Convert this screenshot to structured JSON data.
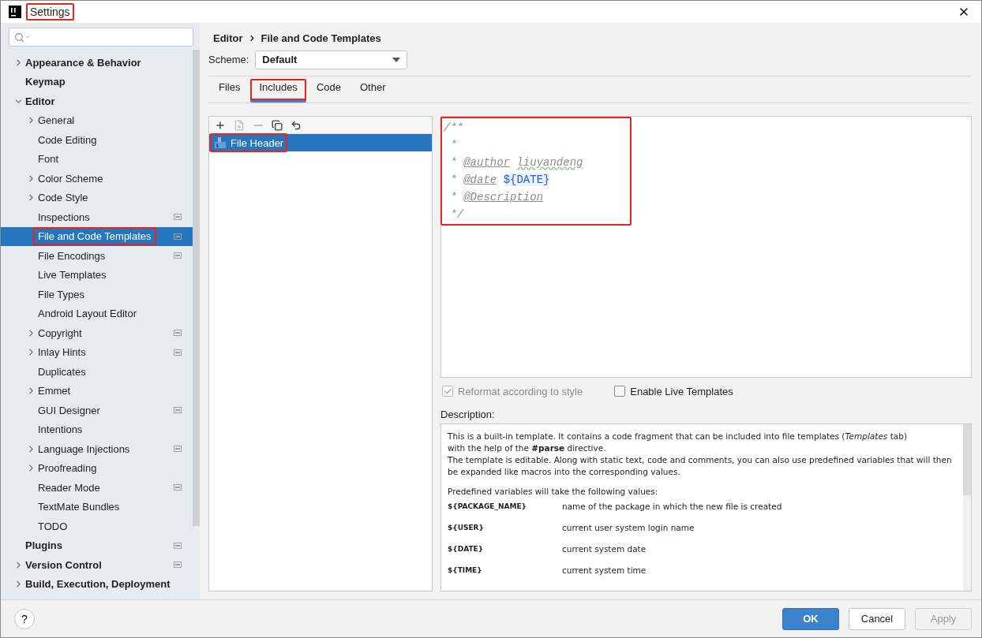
{
  "window": {
    "title": "Settings",
    "title_highlighted": true
  },
  "tree": [
    {
      "label": "Appearance & Behavior",
      "expandable": true,
      "expanded": false,
      "badge": false,
      "selected": false,
      "highlighted": false
    },
    {
      "label": "Keymap",
      "expandable": false,
      "badge": false,
      "selected": false,
      "highlighted": false
    },
    {
      "label": "Editor",
      "expandable": true,
      "expanded": true,
      "badge": false,
      "selected": false,
      "highlighted": false,
      "children": [
        {
          "label": "General",
          "expandable": true,
          "expanded": false,
          "badge": false,
          "selected": false,
          "highlighted": false
        },
        {
          "label": "Code Editing",
          "expandable": false,
          "badge": false,
          "selected": false,
          "highlighted": false
        },
        {
          "label": "Font",
          "expandable": false,
          "badge": false,
          "selected": false,
          "highlighted": false
        },
        {
          "label": "Color Scheme",
          "expandable": true,
          "expanded": false,
          "badge": false,
          "selected": false,
          "highlighted": false
        },
        {
          "label": "Code Style",
          "expandable": true,
          "expanded": false,
          "badge": false,
          "selected": false,
          "highlighted": false
        },
        {
          "label": "Inspections",
          "expandable": false,
          "badge": true,
          "selected": false,
          "highlighted": false
        },
        {
          "label": "File and Code Templates",
          "expandable": false,
          "badge": true,
          "selected": true,
          "highlighted": true
        },
        {
          "label": "File Encodings",
          "expandable": false,
          "badge": true,
          "selected": false,
          "highlighted": false
        },
        {
          "label": "Live Templates",
          "expandable": false,
          "badge": false,
          "selected": false,
          "highlighted": false
        },
        {
          "label": "File Types",
          "expandable": false,
          "badge": false,
          "selected": false,
          "highlighted": false
        },
        {
          "label": "Android Layout Editor",
          "expandable": false,
          "badge": false,
          "selected": false,
          "highlighted": false
        },
        {
          "label": "Copyright",
          "expandable": true,
          "expanded": false,
          "badge": true,
          "selected": false,
          "highlighted": false
        },
        {
          "label": "Inlay Hints",
          "expandable": true,
          "expanded": false,
          "badge": true,
          "selected": false,
          "highlighted": false
        },
        {
          "label": "Duplicates",
          "expandable": false,
          "badge": false,
          "selected": false,
          "highlighted": false
        },
        {
          "label": "Emmet",
          "expandable": true,
          "expanded": false,
          "badge": false,
          "selected": false,
          "highlighted": false
        },
        {
          "label": "GUI Designer",
          "expandable": false,
          "badge": true,
          "selected": false,
          "highlighted": false
        },
        {
          "label": "Intentions",
          "expandable": false,
          "badge": false,
          "selected": false,
          "highlighted": false
        },
        {
          "label": "Language Injections",
          "expandable": true,
          "expanded": false,
          "badge": true,
          "selected": false,
          "highlighted": false
        },
        {
          "label": "Proofreading",
          "expandable": true,
          "expanded": false,
          "badge": false,
          "selected": false,
          "highlighted": false
        },
        {
          "label": "Reader Mode",
          "expandable": false,
          "badge": true,
          "selected": false,
          "highlighted": false
        },
        {
          "label": "TextMate Bundles",
          "expandable": false,
          "badge": false,
          "selected": false,
          "highlighted": false
        },
        {
          "label": "TODO",
          "expandable": false,
          "badge": false,
          "selected": false,
          "highlighted": false
        }
      ]
    },
    {
      "label": "Plugins",
      "expandable": false,
      "badge": true,
      "selected": false,
      "highlighted": false
    },
    {
      "label": "Version Control",
      "expandable": true,
      "expanded": false,
      "badge": true,
      "selected": false,
      "highlighted": false
    },
    {
      "label": "Build, Execution, Deployment",
      "expandable": true,
      "expanded": false,
      "badge": false,
      "selected": false,
      "highlighted": false
    }
  ],
  "breadcrumb": [
    "Editor",
    "File and Code Templates"
  ],
  "scheme": {
    "label": "Scheme:",
    "value": "Default"
  },
  "tabs": [
    {
      "label": "Files",
      "selected": false,
      "highlighted": false
    },
    {
      "label": "Includes",
      "selected": true,
      "highlighted": true
    },
    {
      "label": "Code",
      "selected": false,
      "highlighted": false
    },
    {
      "label": "Other",
      "selected": false,
      "highlighted": false
    }
  ],
  "toolbar": [
    {
      "kind": "add",
      "disabled": false
    },
    {
      "kind": "add-child",
      "disabled": true
    },
    {
      "kind": "remove",
      "disabled": true
    },
    {
      "kind": "copy",
      "disabled": false
    },
    {
      "kind": "reset",
      "disabled": false
    }
  ],
  "templates": [
    {
      "label": "File Header",
      "selected": true,
      "highlighted": true
    }
  ],
  "editor": {
    "highlighted": true,
    "lines": [
      [
        {
          "kind": "comment",
          "text": "/**"
        }
      ],
      [
        {
          "kind": "comment",
          "text": " *"
        }
      ],
      [
        {
          "kind": "comment",
          "text": " * "
        },
        {
          "kind": "tag",
          "text": "@author"
        },
        {
          "kind": "typo",
          "text": "liuyandeng"
        }
      ],
      [
        {
          "kind": "comment",
          "text": " * "
        },
        {
          "kind": "tag",
          "text": "@date"
        },
        {
          "kind": "variable",
          "text": "${DATE}"
        }
      ],
      [
        {
          "kind": "comment",
          "text": " * "
        },
        {
          "kind": "tag",
          "text": "@Description"
        }
      ],
      [
        {
          "kind": "comment",
          "text": " */"
        }
      ]
    ]
  },
  "options": [
    {
      "label": "Reformat according to style",
      "checked": true,
      "disabled": true
    },
    {
      "label": "Enable Live Templates",
      "checked": false,
      "disabled": false
    }
  ],
  "description": {
    "label": "Description:",
    "paragraphs": [
      "This is a built-in template. It contains a code fragment that can be included into file templates (*Templates* tab)",
      "with the help of the **#parse** directive.",
      "The template is editable. Along with static text, code and comments, you can also use predefined variables that will then be expanded like macros into the corresponding values."
    ],
    "intro": "Predefined variables will take the following values:",
    "variables": [
      {
        "name": "${PACKAGE_NAME}",
        "meaning": "name of the package in which the new file is created"
      },
      {
        "name": "${USER}",
        "meaning": "current user system login name"
      },
      {
        "name": "${DATE}",
        "meaning": "current system date"
      },
      {
        "name": "${TIME}",
        "meaning": "current system time"
      }
    ]
  },
  "buttons": [
    {
      "label": "OK",
      "kind": "primary",
      "disabled": false
    },
    {
      "label": "Cancel",
      "kind": "normal",
      "disabled": false
    },
    {
      "label": "Apply",
      "kind": "normal",
      "disabled": true
    }
  ],
  "help": "?"
}
